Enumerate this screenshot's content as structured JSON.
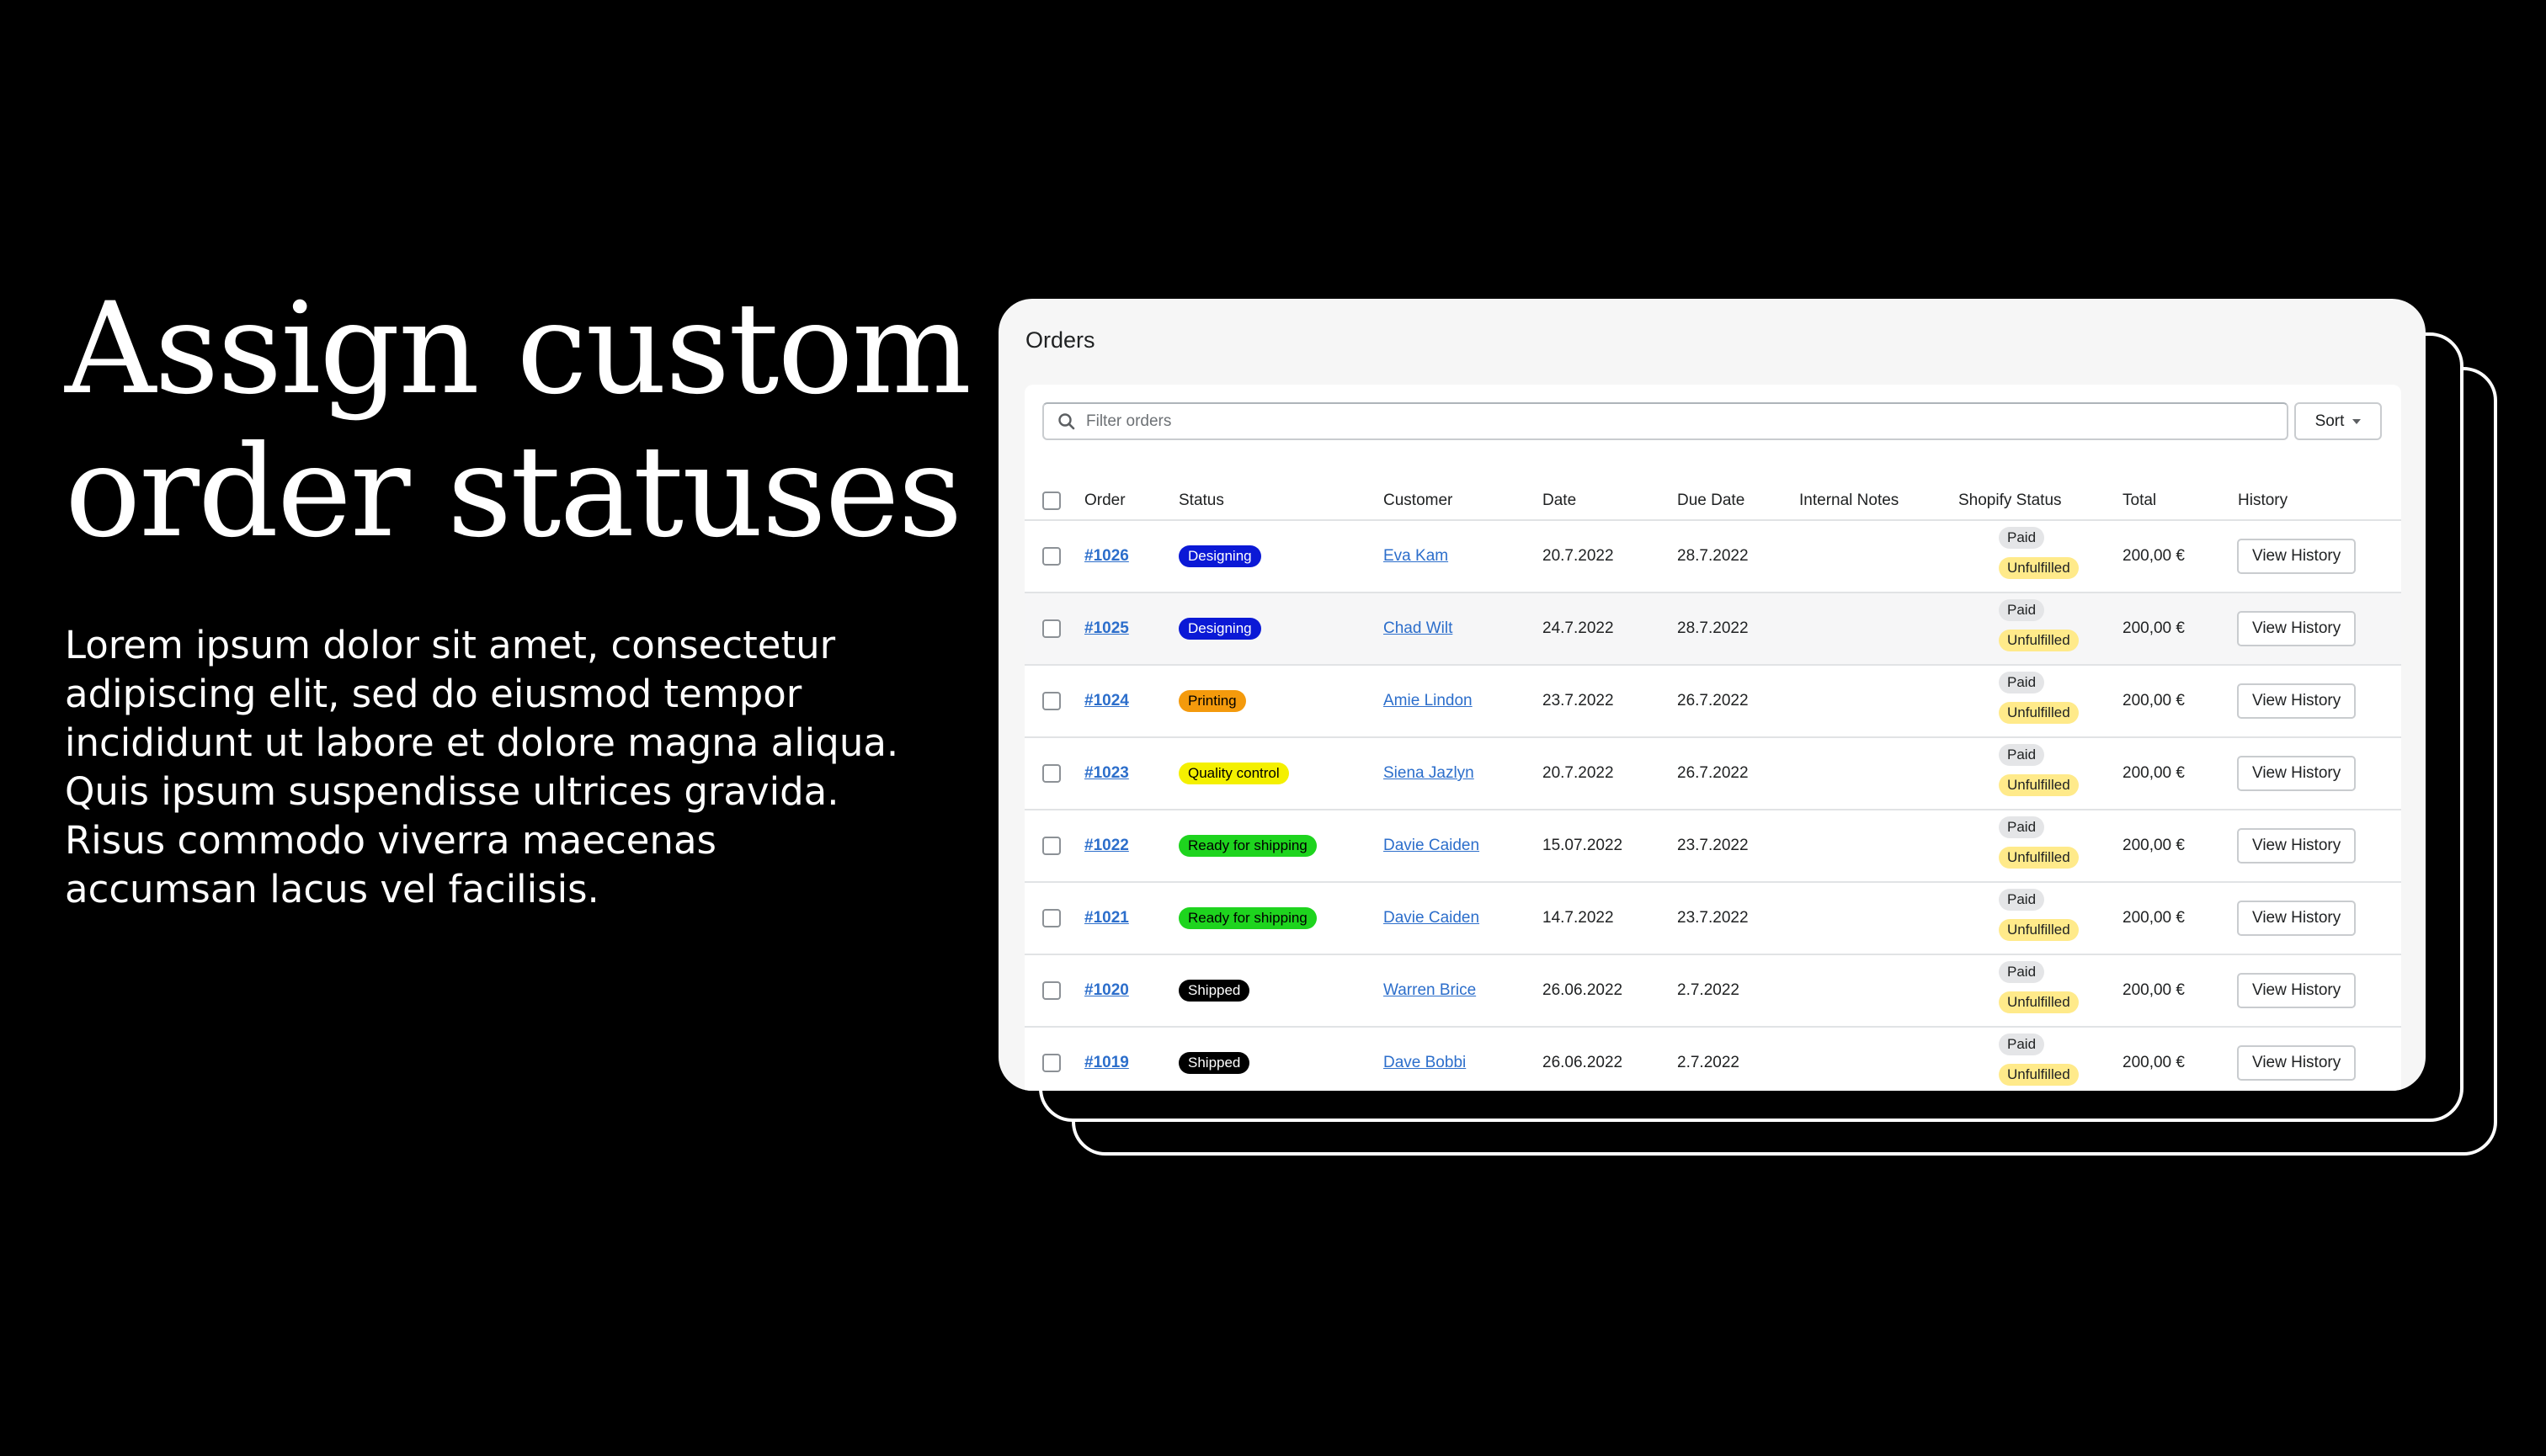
{
  "hero": {
    "headline_line1": "Assign custom",
    "headline_line2": "order statuses",
    "body": "Lorem ipsum dolor sit amet, consectetur adipiscing elit, sed do eiusmod tempor incididunt ut labore et dolore magna aliqua. Quis ipsum suspendisse ultrices gravida. Risus commodo viverra maecenas accumsan lacus vel facilisis."
  },
  "orders": {
    "title": "Orders",
    "search_placeholder": "Filter orders",
    "sort_label": "Sort",
    "columns": [
      "Order",
      "Status",
      "Customer",
      "Date",
      "Due Date",
      "Internal Notes",
      "Shopify Status",
      "Total",
      "History"
    ],
    "status_colors": {
      "Designing": {
        "bg": "#0b19d6",
        "fg": "#ffffff"
      },
      "Printing": {
        "bg": "#f49a0c",
        "fg": "#000000"
      },
      "Quality control": {
        "bg": "#f4f000",
        "fg": "#000000"
      },
      "Ready for shipping": {
        "bg": "#1ed41e",
        "fg": "#000000"
      },
      "Shipped": {
        "bg": "#000000",
        "fg": "#ffffff"
      }
    },
    "rows": [
      {
        "order": "#1026",
        "status": "Designing",
        "customer": "Eva Kam",
        "date": "20.7.2022",
        "due": "28.7.2022",
        "notes": "",
        "payment": "Paid",
        "fulfillment": "Unfulfilled",
        "total": "200,00 €",
        "history": "View History"
      },
      {
        "order": "#1025",
        "status": "Designing",
        "customer": "Chad Wilt",
        "date": "24.7.2022",
        "due": "28.7.2022",
        "notes": "",
        "payment": "Paid",
        "fulfillment": "Unfulfilled",
        "total": "200,00 €",
        "history": "View History"
      },
      {
        "order": "#1024",
        "status": "Printing",
        "customer": "Amie Lindon",
        "date": "23.7.2022",
        "due": "26.7.2022",
        "notes": "",
        "payment": "Paid",
        "fulfillment": "Unfulfilled",
        "total": "200,00 €",
        "history": "View History"
      },
      {
        "order": "#1023",
        "status": "Quality control",
        "customer": "Siena Jazlyn",
        "date": "20.7.2022",
        "due": "26.7.2022",
        "notes": "",
        "payment": "Paid",
        "fulfillment": "Unfulfilled",
        "total": "200,00 €",
        "history": "View History"
      },
      {
        "order": "#1022",
        "status": "Ready for shipping",
        "customer": "Davie Caiden",
        "date": "15.07.2022",
        "due": "23.7.2022",
        "notes": "",
        "payment": "Paid",
        "fulfillment": "Unfulfilled",
        "total": "200,00 €",
        "history": "View History"
      },
      {
        "order": "#1021",
        "status": "Ready for shipping",
        "customer": "Davie Caiden",
        "date": "14.7.2022",
        "due": "23.7.2022",
        "notes": "",
        "payment": "Paid",
        "fulfillment": "Unfulfilled",
        "total": "200,00 €",
        "history": "View History"
      },
      {
        "order": "#1020",
        "status": "Shipped",
        "customer": "Warren Brice",
        "date": "26.06.2022",
        "due": "2.7.2022",
        "notes": "",
        "payment": "Paid",
        "fulfillment": "Unfulfilled",
        "total": "200,00 €",
        "history": "View History"
      },
      {
        "order": "#1019",
        "status": "Shipped",
        "customer": "Dave Bobbi",
        "date": "26.06.2022",
        "due": "2.7.2022",
        "notes": "",
        "payment": "Paid",
        "fulfillment": "Unfulfilled",
        "total": "200,00 €",
        "history": "View History"
      }
    ]
  }
}
